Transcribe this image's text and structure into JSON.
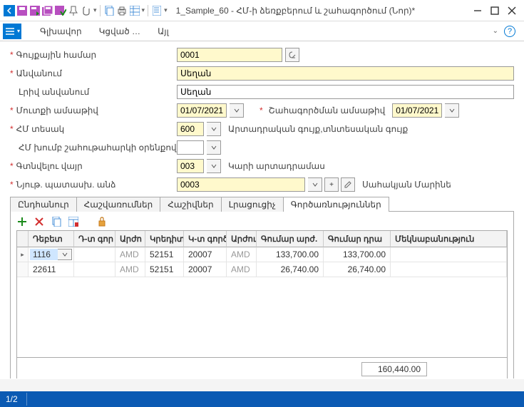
{
  "title": "1_Sample_60 - ՀՄ-ի ձեռքբերում և շահագործում (Նոր)*",
  "menu": {
    "m1": "Գլխավոր",
    "m2": "Կցված …",
    "m3": "Այլ"
  },
  "form": {
    "l_inventory_no": "Գույքային համար",
    "v_inventory_no": "0001",
    "l_name": "Անվանում",
    "v_name": "Սեղան",
    "l_fullname": "Լրիվ անվանում",
    "v_fullname": "Սեղան",
    "l_entry_date": "Մուտքի ամսաթիվ",
    "v_entry_date": "01/07/2021",
    "l_op_date": "Շահագործման ամսաթիվ",
    "v_op_date": "01/07/2021",
    "l_type": "ՀՄ տեսակ",
    "v_type": "600",
    "v_type_text": "Արտադրական գույք,տնտեսական գույք",
    "l_tax_group": "ՀՄ խումբ շահութահարկի օրենքով",
    "l_location": "Գտնվելու վայր",
    "v_location": "003",
    "v_location_text": "Կարի արտադրամաս",
    "l_person": "Նյութ. պատասխ. անձ",
    "v_person": "0003",
    "v_person_text": "Սահակյան Մարինե"
  },
  "tabs": {
    "t1": "Ընդհանուր",
    "t2": "Հաշվառումներ",
    "t3": "Հաշիվներ",
    "t4": "Լրացուցիչ",
    "t5": "Գործառնություններ"
  },
  "grid": {
    "headers": {
      "h1": "Դեբետ",
      "h2": "Դ-տ գոր",
      "h3": "Արժո",
      "h4": "Կրեդիտ",
      "h5": "Կ-տ գործ",
      "h6": "Արժու",
      "h7": "Գումար արժ.",
      "h8": "Գումար դրա",
      "h9": "Մեկնաբանություն"
    },
    "rows": [
      {
        "debit": "1116",
        "dpart": "",
        "cur1": "AMD",
        "credit": "52151",
        "cpart": "20007",
        "cur2": "AMD",
        "amt_cur": "133,700.00",
        "amt_dram": "133,700.00",
        "note": ""
      },
      {
        "debit": "22611",
        "dpart": "",
        "cur1": "AMD",
        "credit": "52151",
        "cpart": "20007",
        "cur2": "AMD",
        "amt_cur": "26,740.00",
        "amt_dram": "26,740.00",
        "note": ""
      }
    ],
    "total": "160,440.00"
  },
  "status": {
    "page": "1/2"
  }
}
